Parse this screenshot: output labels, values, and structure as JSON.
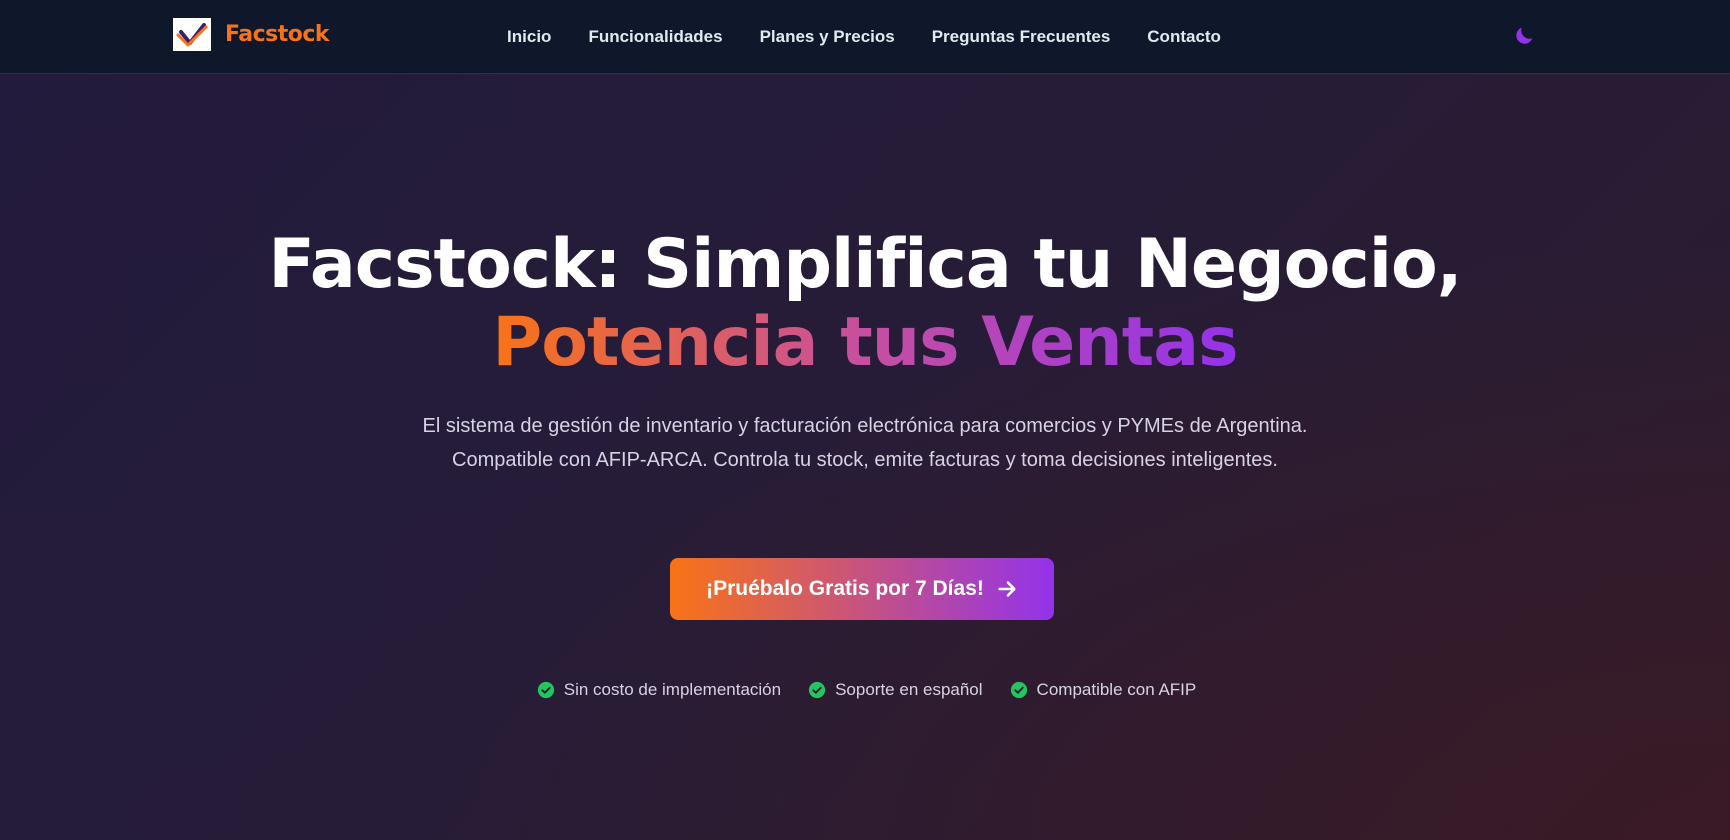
{
  "brand": {
    "name": "Facstock",
    "logo_icon": "check-mark-logo-icon",
    "color": "#f97316"
  },
  "nav": {
    "links": [
      {
        "label": "Inicio"
      },
      {
        "label": "Funcionalidades"
      },
      {
        "label": "Planes y Precios"
      },
      {
        "label": "Preguntas Frecuentes"
      },
      {
        "label": "Contacto"
      }
    ],
    "theme_toggle_icon": "moon-icon"
  },
  "hero": {
    "title_line1": "Facstock: Simplifica tu Negocio,",
    "title_line2": "Potencia tus Ventas",
    "description": "El sistema de gestión de inventario y facturación electrónica para comercios y PYMEs de Argentina. Compatible con AFIP-ARCA. Controla tu stock, emite facturas y toma decisiones inteligentes.",
    "cta_label": "¡Pruébalo Gratis por 7 Días!",
    "cta_icon": "arrow-right-icon",
    "features": [
      {
        "label": "Sin costo de implementación",
        "icon": "check-circle-icon"
      },
      {
        "label": "Soporte en español",
        "icon": "check-circle-icon"
      },
      {
        "label": "Compatible con AFIP",
        "icon": "check-circle-icon"
      }
    ]
  },
  "colors": {
    "accent_orange": "#f97316",
    "accent_purple": "#9333ea",
    "check_green": "#22c55e",
    "nav_bg": "#0f172a"
  }
}
